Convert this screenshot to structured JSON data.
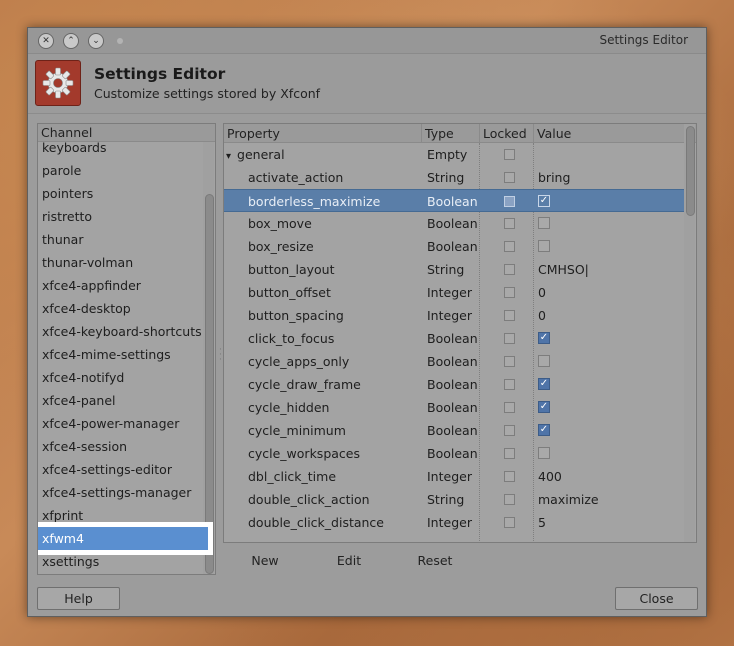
{
  "window": {
    "title": "Settings Editor",
    "close_glyph": "✕",
    "min_glyph": "⌃",
    "max_glyph": "⌄"
  },
  "header": {
    "title": "Settings Editor",
    "subtitle": "Customize settings stored by Xfconf",
    "icon": "gear-icon"
  },
  "channels": {
    "header": "Channel",
    "items": [
      "keyboards",
      "parole",
      "pointers",
      "ristretto",
      "thunar",
      "thunar-volman",
      "xfce4-appfinder",
      "xfce4-desktop",
      "xfce4-keyboard-shortcuts",
      "xfce4-mime-settings",
      "xfce4-notifyd",
      "xfce4-panel",
      "xfce4-power-manager",
      "xfce4-session",
      "xfce4-settings-editor",
      "xfce4-settings-manager",
      "xfprint",
      "xfwm4",
      "xsettings"
    ],
    "selected": "xfwm4"
  },
  "properties": {
    "columns": {
      "property": "Property",
      "type": "Type",
      "locked": "Locked",
      "value": "Value"
    },
    "expander_glyph": "▾",
    "rows": [
      {
        "property": "general",
        "type": "Empty",
        "value": "",
        "kind": "parent"
      },
      {
        "property": "activate_action",
        "type": "String",
        "value": "bring",
        "kind": "text"
      },
      {
        "property": "borderless_maximize",
        "type": "Boolean",
        "value": "true",
        "kind": "bool",
        "selected": true
      },
      {
        "property": "box_move",
        "type": "Boolean",
        "value": "false",
        "kind": "bool"
      },
      {
        "property": "box_resize",
        "type": "Boolean",
        "value": "false",
        "kind": "bool"
      },
      {
        "property": "button_layout",
        "type": "String",
        "value": "CMHSO|",
        "kind": "text"
      },
      {
        "property": "button_offset",
        "type": "Integer",
        "value": "0",
        "kind": "text"
      },
      {
        "property": "button_spacing",
        "type": "Integer",
        "value": "0",
        "kind": "text"
      },
      {
        "property": "click_to_focus",
        "type": "Boolean",
        "value": "true",
        "kind": "bool"
      },
      {
        "property": "cycle_apps_only",
        "type": "Boolean",
        "value": "false",
        "kind": "bool"
      },
      {
        "property": "cycle_draw_frame",
        "type": "Boolean",
        "value": "true",
        "kind": "bool"
      },
      {
        "property": "cycle_hidden",
        "type": "Boolean",
        "value": "true",
        "kind": "bool"
      },
      {
        "property": "cycle_minimum",
        "type": "Boolean",
        "value": "true",
        "kind": "bool"
      },
      {
        "property": "cycle_workspaces",
        "type": "Boolean",
        "value": "false",
        "kind": "bool"
      },
      {
        "property": "dbl_click_time",
        "type": "Integer",
        "value": "400",
        "kind": "text"
      },
      {
        "property": "double_click_action",
        "type": "String",
        "value": "maximize",
        "kind": "text"
      },
      {
        "property": "double_click_distance",
        "type": "Integer",
        "value": "5",
        "kind": "text"
      }
    ],
    "check_glyph": "✓"
  },
  "actions": {
    "new": "New",
    "edit": "Edit",
    "reset": "Reset"
  },
  "footer": {
    "help": "Help",
    "close": "Close"
  }
}
